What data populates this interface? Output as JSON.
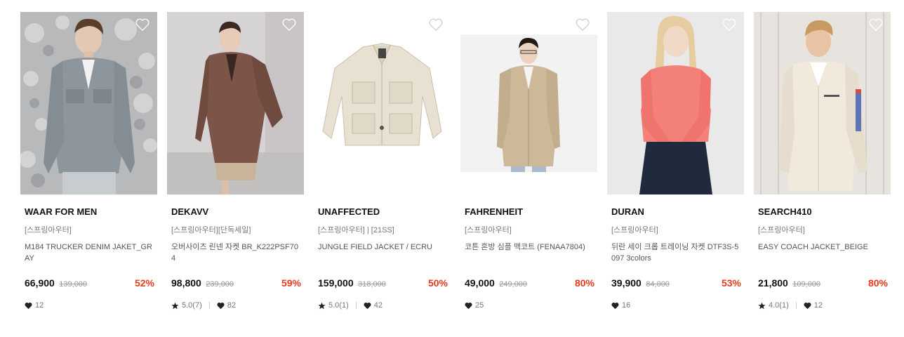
{
  "products": [
    {
      "brand": "WAAR FOR MEN",
      "category": "[스프링아우터]",
      "title": "M184 TRUCKER DENIM JAKET_GRAY",
      "price": "66,900",
      "original_price": "139,000",
      "discount": "52%",
      "rating": null,
      "likes": "12",
      "heart_icon": "heart-outline-icon"
    },
    {
      "brand": "DEKAVV",
      "category": "[스프링아우터][단독세일]",
      "title": "오버사이즈 린넨 자켓 BR_K222PSF704",
      "price": "98,800",
      "original_price": "239,000",
      "discount": "59%",
      "rating": "5.0(7)",
      "likes": "82",
      "heart_icon": "heart-outline-icon"
    },
    {
      "brand": "UNAFFECTED",
      "category": "[스프링아우터] | [21SS]",
      "title": "JUNGLE FIELD JACKET / ECRU",
      "price": "159,000",
      "original_price": "318,000",
      "discount": "50%",
      "rating": "5.0(1)",
      "likes": "42",
      "heart_icon": "heart-outline-icon"
    },
    {
      "brand": "FAHRENHEIT",
      "category": "[스프링아우터]",
      "title": "코튼 혼방 심플 맥코트 (FENAA7804)",
      "price": "49,000",
      "original_price": "249,000",
      "discount": "80%",
      "rating": null,
      "likes": "25",
      "heart_icon": "heart-outline-icon"
    },
    {
      "brand": "DURAN",
      "category": "[스프링아우터]",
      "title": "뒤란 세이 크롭 트레이닝 자켓 DTF3S-5097 3colors",
      "price": "39,900",
      "original_price": "84,000",
      "discount": "53%",
      "rating": null,
      "likes": "16",
      "heart_icon": "heart-outline-icon"
    },
    {
      "brand": "SEARCH410",
      "category": "[스프링아우터]",
      "title": "EASY COACH JACKET_BEIGE",
      "price": "21,800",
      "original_price": "109,000",
      "discount": "80%",
      "rating": "4.0(1)",
      "likes": "12",
      "heart_icon": "heart-outline-icon"
    }
  ],
  "colors": {
    "discount": "#e8391c",
    "brand_text": "#111111",
    "meta_text": "#777777"
  }
}
